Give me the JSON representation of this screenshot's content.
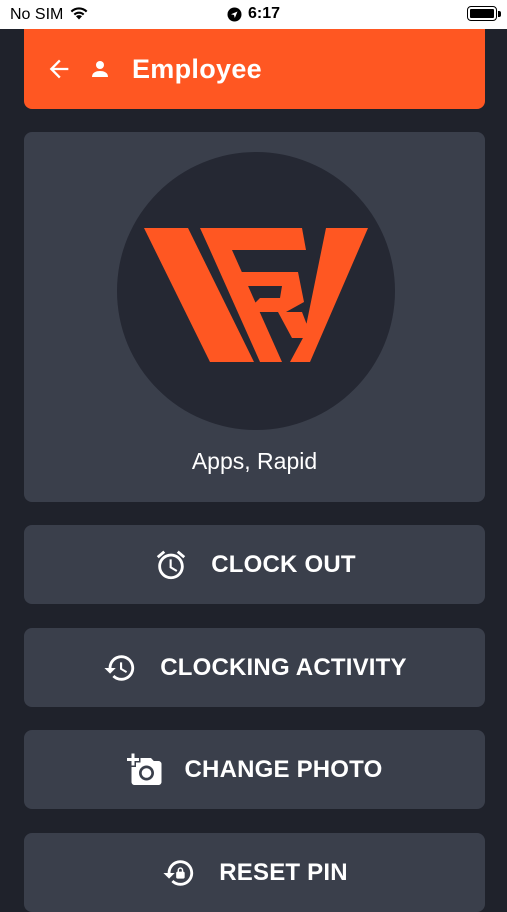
{
  "status_bar": {
    "carrier": "No SIM",
    "time": "6:17"
  },
  "header": {
    "title": "Employee",
    "icons": [
      "back-arrow-icon",
      "person-icon"
    ]
  },
  "profile": {
    "name": "Apps, Rapid",
    "logo_colors": {
      "accent": "#ff5722",
      "circle": "#252833"
    }
  },
  "actions": [
    {
      "label": "CLOCK OUT",
      "icon": "alarm-clock-icon"
    },
    {
      "label": "CLOCKING ACTIVITY",
      "icon": "history-icon"
    },
    {
      "label": "CHANGE PHOTO",
      "icon": "add-photo-icon"
    },
    {
      "label": "RESET PIN",
      "icon": "lock-reset-icon"
    }
  ],
  "colors": {
    "background": "#1f222b",
    "card": "#3a3f4b",
    "accent": "#ff5722",
    "text": "#ffffff"
  }
}
